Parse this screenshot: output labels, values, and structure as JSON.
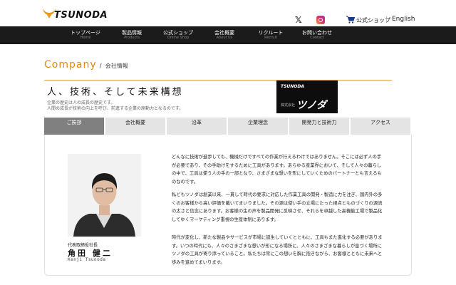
{
  "header": {
    "logo_text": "TSUNODA",
    "social": {
      "x_icon": "x-icon",
      "instagram_icon": "instagram-icon"
    },
    "shop_label": "公式ショップ",
    "separator": "|",
    "language_label": "English"
  },
  "nav": {
    "items": [
      {
        "jp": "トップページ",
        "en": "Home"
      },
      {
        "jp": "製品情報",
        "en": "Products"
      },
      {
        "jp": "公式ショップ",
        "en": "Online Shop"
      },
      {
        "jp": "会社概要",
        "en": "About Us"
      },
      {
        "jp": "リクルート",
        "en": "Recruit"
      },
      {
        "jp": "お問い合わせ",
        "en": "Contact"
      }
    ]
  },
  "page": {
    "title_en": "Company",
    "title_slash": "/",
    "title_jp": "会社情報",
    "headline": "人、技術、そして未来構想",
    "subtitle_line1": "企業の歴史は人の成長の歴史です。",
    "subtitle_line2": "人間の成長が技術の向上を呼び、前進する企業の原動力となるのです。",
    "brand_image": {
      "logo": "TSUNODA",
      "caption": "株式会社",
      "script": "ツノダ"
    }
  },
  "tabs": [
    {
      "label": "ご挨拶",
      "active": true
    },
    {
      "label": "会社概要",
      "active": false
    },
    {
      "label": "沿革",
      "active": false
    },
    {
      "label": "企業理念",
      "active": false
    },
    {
      "label": "開発力と技術力",
      "active": false
    },
    {
      "label": "アクセス",
      "active": false
    }
  ],
  "greeting": {
    "role": "代表取締役社長",
    "name": "角田 健二",
    "name_en": "Kenji Tsunoda",
    "paragraph1_lines": [
      "どんなに技術が進歩しても、機械だけですべての作業が行えるわけではありません。そこには必ず人の手",
      "が必要であり、その手助けをするために工具があります。あらゆる産業界において、そして人々の暮らし",
      "の中で、工具は使う人の手の一部となり、さまざまな想いを形にしていくためのパートナーとも言えるも",
      "のなのです。"
    ],
    "paragraph2_lines": [
      "私どもツノダは創業以来、一貫して時代の要求に対応した作業工具の開発・製造に力を注ぎ、国内外の多",
      "くのお客様から高い評価を戴いてまいりました。その源は使い手の立場にたった視点とものづくりの源流",
      "の太さと信念にあります。お客様の生の声を製品開発に反映させ、それらを卓越した高機能工場で製品化",
      "してゆくマーケティング重視の生産体制にあります。"
    ],
    "paragraph3_lines": [
      "時代が変化し、新たな製品やサービスが市場に誕生していくとともに、工具もまた進化する必要がありま",
      "す。いつの時代にも、人々のさまざまな想いが形になる場所に、人々のさまざまな暮らしが息づく場所に",
      "ツノダの工具が寄り添っていること。私たちは常にこの想いを胸に抱きながら、お客様とともに未来へと",
      "歩みを進めてまいります。"
    ]
  },
  "colors": {
    "accent": "#e08a12",
    "nav_background": "#1b1b1b",
    "tab_active": "#808080",
    "tab_inactive": "#e4e4e4"
  }
}
